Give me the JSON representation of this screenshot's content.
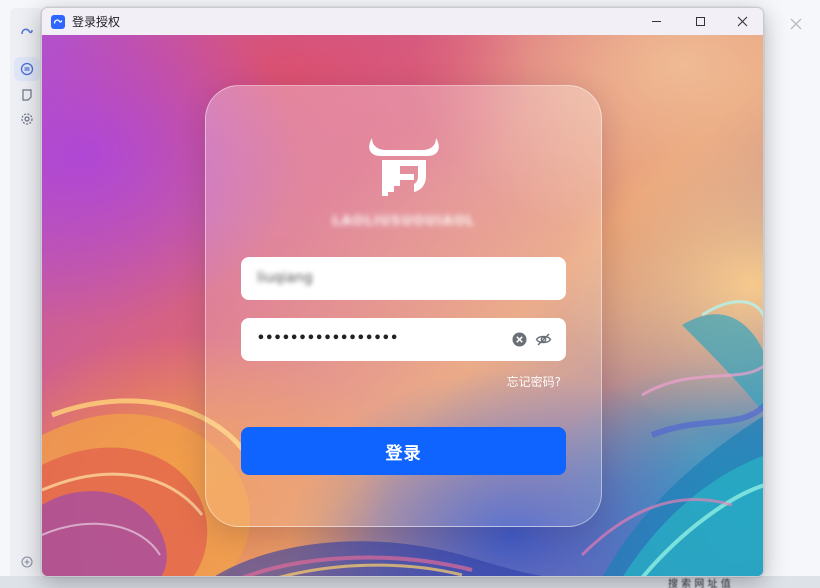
{
  "window": {
    "title": "登录授权",
    "icon": "app-logo-icon",
    "controls": [
      "minimize-icon",
      "maximize-icon",
      "close-icon"
    ]
  },
  "login": {
    "brand_name": "LAOLIUSUOUIAOL",
    "username_value": "liuqiang",
    "password_masked": "•••••••••••••••••",
    "forgot_password": "忘记密码?",
    "submit_label": "登录"
  },
  "taskbar": {
    "text": "搜 索 网 址 值"
  },
  "colors": {
    "accent": "#0f63ff",
    "titlebar": "#f3eff7"
  }
}
